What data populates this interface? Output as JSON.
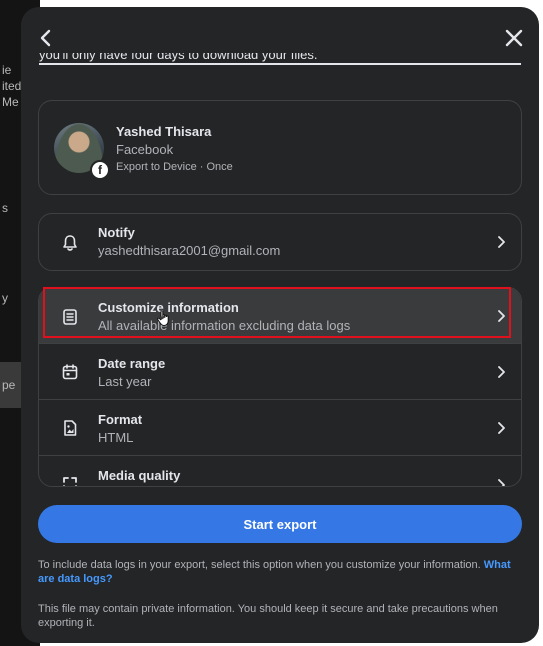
{
  "background": {
    "fragments": [
      "ie",
      "ited",
      "Me",
      "s",
      "y",
      "pe"
    ]
  },
  "header": {
    "back_icon": "chevron-left-icon",
    "close_icon": "close-icon",
    "clipped_text": "you'll only have four days to download your files."
  },
  "profile": {
    "name": "Yashed Thisara",
    "platform": "Facebook",
    "detail": "Export to Device · Once",
    "badge_icon": "facebook-icon"
  },
  "notify": {
    "icon": "bell-icon",
    "title": "Notify",
    "value": "yashedthisara2001@gmail.com"
  },
  "options": [
    {
      "icon": "document-list-icon",
      "title": "Customize information",
      "value": "All available information excluding data logs"
    },
    {
      "icon": "calendar-icon",
      "title": "Date range",
      "value": "Last year"
    },
    {
      "icon": "image-file-icon",
      "title": "Format",
      "value": "HTML"
    },
    {
      "icon": "expand-icon",
      "title": "Media quality",
      "value": ""
    }
  ],
  "actions": {
    "start_label": "Start export"
  },
  "notes": {
    "data_logs_text": "To include data logs in your export, select this option when you customize your information.",
    "data_logs_link": "What are data logs?",
    "privacy_text": "This file may contain private information. You should keep it secure and take precautions when exporting it."
  },
  "colors": {
    "modal_bg": "#242526",
    "primary": "#3578e5",
    "link": "#4599ff",
    "highlight": "#e0111d"
  }
}
